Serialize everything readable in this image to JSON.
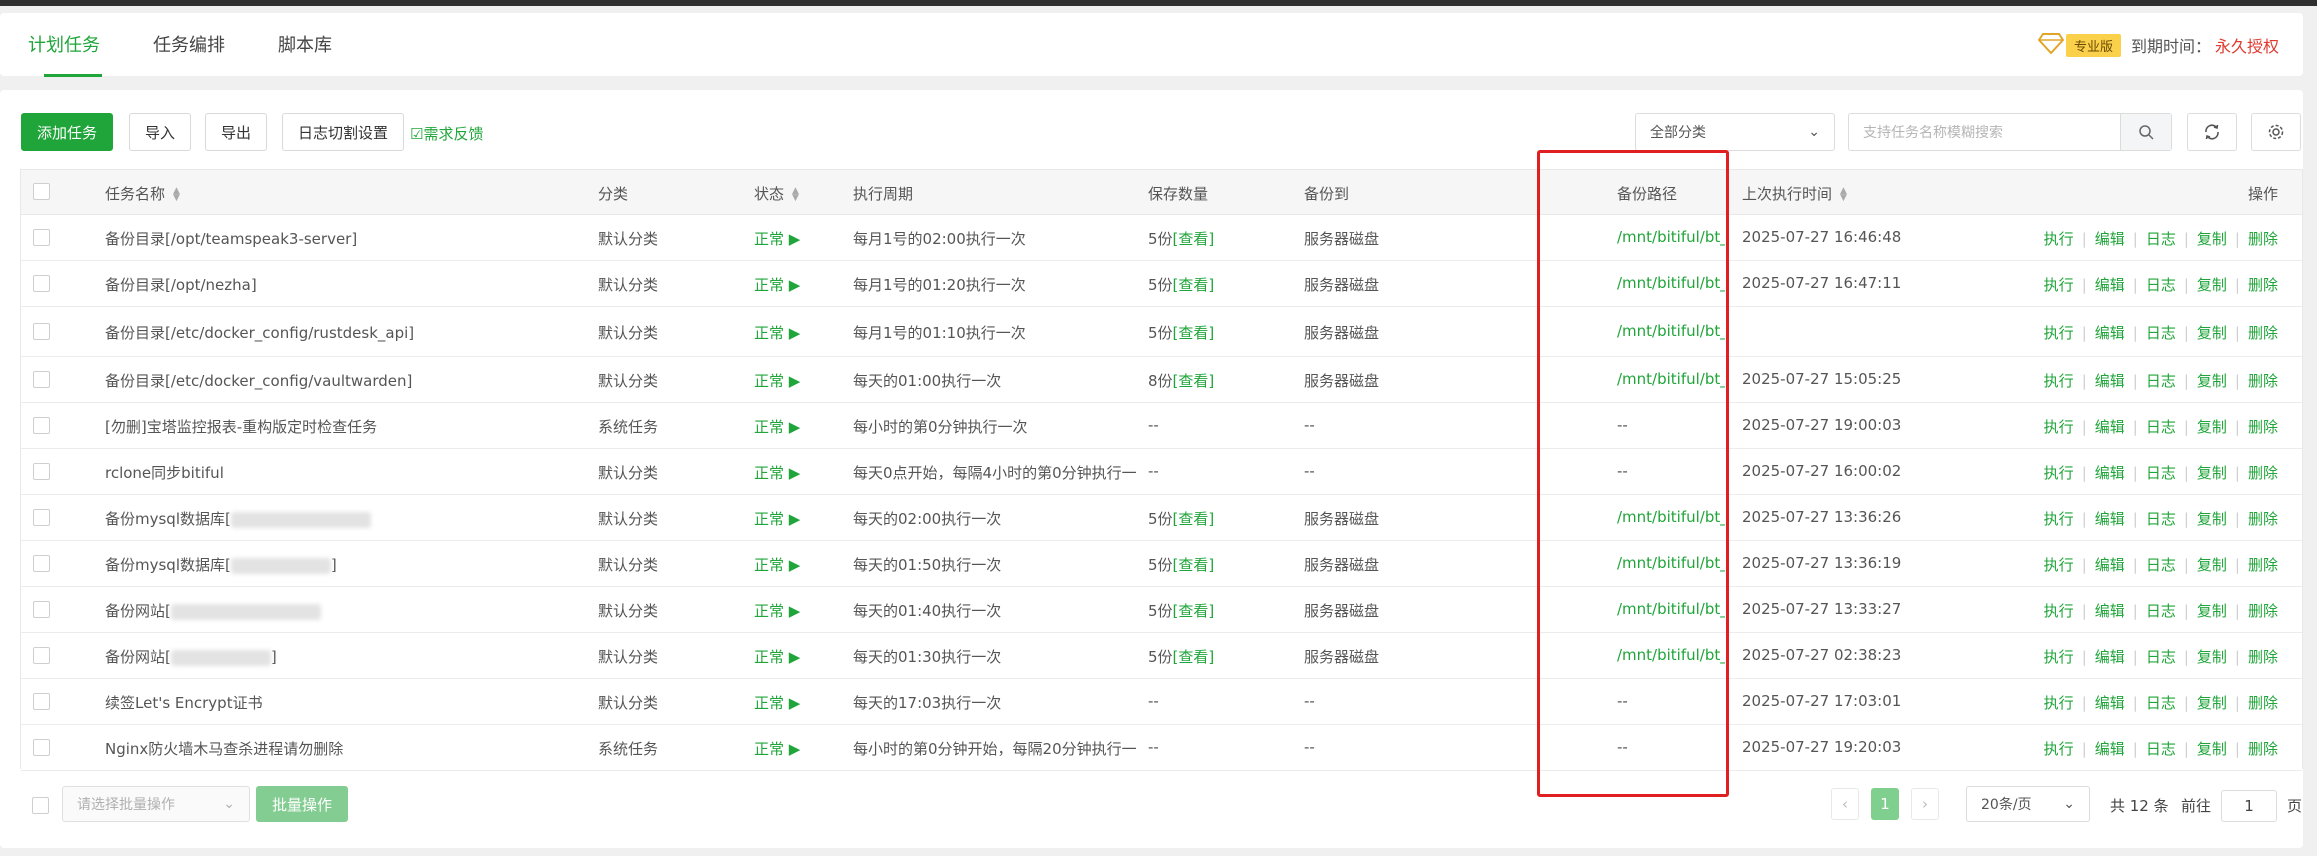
{
  "tabs": [
    {
      "label": "计划任务",
      "active": true
    },
    {
      "label": "任务编排",
      "active": false
    },
    {
      "label": "脚本库",
      "active": false
    }
  ],
  "license": {
    "badge": "专业版",
    "expire_label": "到期时间：",
    "expire_value": "永久授权"
  },
  "toolbar": {
    "add": "添加任务",
    "import": "导入",
    "export": "导出",
    "log_split": "日志切割设置",
    "feedback": "需求反馈",
    "category": "全部分类",
    "search_placeholder": "支持任务名称模糊搜索"
  },
  "columns": {
    "name": "任务名称",
    "category": "分类",
    "status": "状态",
    "cycle": "执行周期",
    "keep": "保存数量",
    "backup_to": "备份到",
    "backup_path": "备份路径",
    "last_run": "上次执行时间",
    "ops": "操作"
  },
  "ops": {
    "run": "执行",
    "edit": "编辑",
    "log": "日志",
    "copy": "复制",
    "delete": "删除"
  },
  "rows": [
    {
      "name": "备份目录[/opt/teamspeak3-server]",
      "category": "默认分类",
      "status": "正常",
      "cycle": "每月1号的02:00执行一次",
      "keep": "5份",
      "keep_link": "[查看]",
      "backup_to": "服务器磁盘",
      "path": "/mnt/bitiful/bt_",
      "last_run": "2025-07-27 16:46:48"
    },
    {
      "name": "备份目录[/opt/nezha]",
      "category": "默认分类",
      "status": "正常",
      "cycle": "每月1号的01:20执行一次",
      "keep": "5份",
      "keep_link": "[查看]",
      "backup_to": "服务器磁盘",
      "path": "/mnt/bitiful/bt_",
      "last_run": "2025-07-27 16:47:11"
    },
    {
      "name": "备份目录[/etc/docker_config/rustdesk_api]",
      "category": "默认分类",
      "status": "正常",
      "cycle": "每月1号的01:10执行一次",
      "keep": "5份",
      "keep_link": "[查看]",
      "backup_to": "服务器磁盘",
      "path": "/mnt/bitiful/bt_",
      "last_run": ""
    },
    {
      "name": "备份目录[/etc/docker_config/vaultwarden]",
      "category": "默认分类",
      "status": "正常",
      "cycle": "每天的01:00执行一次",
      "keep": "8份",
      "keep_link": "[查看]",
      "backup_to": "服务器磁盘",
      "path": "/mnt/bitiful/bt_",
      "last_run": "2025-07-27 15:05:25"
    },
    {
      "name": "[勿删]宝塔监控报表-重构版定时检查任务",
      "category": "系统任务",
      "status": "正常",
      "cycle": "每小时的第0分钟执行一次",
      "keep": "--",
      "keep_link": "",
      "backup_to": "--",
      "path": "--",
      "last_run": "2025-07-27 19:00:03"
    },
    {
      "name": "rclone同步bitiful",
      "category": "默认分类",
      "status": "正常",
      "cycle": "每天0点开始，每隔4小时的第0分钟执行一",
      "keep": "--",
      "keep_link": "",
      "backup_to": "--",
      "path": "--",
      "last_run": "2025-07-27 16:00:02"
    },
    {
      "name": "备份mysql数据库[",
      "category": "默认分类",
      "status": "正常",
      "cycle": "每天的02:00执行一次",
      "keep": "5份",
      "keep_link": "[查看]",
      "backup_to": "服务器磁盘",
      "path": "/mnt/bitiful/bt_",
      "last_run": "2025-07-27 13:36:26"
    },
    {
      "name": "备份mysql数据库[",
      "category": "默认分类",
      "status": "正常",
      "cycle": "每天的01:50执行一次",
      "keep": "5份",
      "keep_link": "[查看]",
      "backup_to": "服务器磁盘",
      "path": "/mnt/bitiful/bt_",
      "last_run": "2025-07-27 13:36:19"
    },
    {
      "name": "备份网站[",
      "category": "默认分类",
      "status": "正常",
      "cycle": "每天的01:40执行一次",
      "keep": "5份",
      "keep_link": "[查看]",
      "backup_to": "服务器磁盘",
      "path": "/mnt/bitiful/bt_",
      "last_run": "2025-07-27 13:33:27"
    },
    {
      "name": "备份网站[",
      "category": "默认分类",
      "status": "正常",
      "cycle": "每天的01:30执行一次",
      "keep": "5份",
      "keep_link": "[查看]",
      "backup_to": "服务器磁盘",
      "path": "/mnt/bitiful/bt_",
      "last_run": "2025-07-27 02:38:23"
    },
    {
      "name": "续签Let's Encrypt证书",
      "category": "默认分类",
      "status": "正常",
      "cycle": "每天的17:03执行一次",
      "keep": "--",
      "keep_link": "",
      "backup_to": "--",
      "path": "--",
      "last_run": "2025-07-27 17:03:01"
    },
    {
      "name": "Nginx防火墙木马查杀进程请勿删除",
      "category": "系统任务",
      "status": "正常",
      "cycle": "每小时的第0分钟开始，每隔20分钟执行一",
      "keep": "--",
      "keep_link": "",
      "backup_to": "--",
      "path": "--",
      "last_run": "2025-07-27 19:20:03"
    }
  ],
  "footer": {
    "batch_placeholder": "请选择批量操作",
    "batch_btn": "批量操作",
    "page": "1",
    "page_size": "20条/页",
    "total": "共 12 条",
    "goto": "前往",
    "goto_value": "1",
    "page_unit": "页"
  },
  "colors": {
    "accent": "#20a53a",
    "highlight": "#e02020"
  }
}
